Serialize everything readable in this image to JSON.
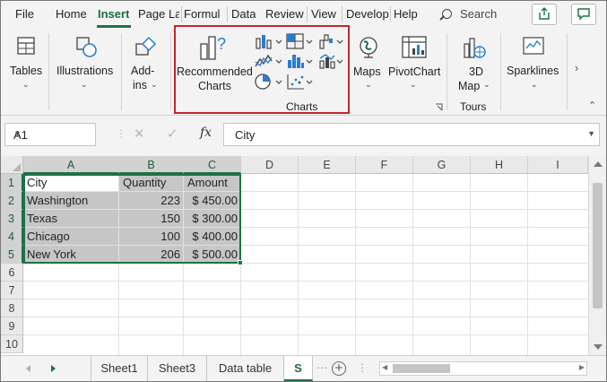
{
  "tabs": [
    {
      "label": "File"
    },
    {
      "label": "Home"
    },
    {
      "label": "Insert",
      "active": true
    },
    {
      "label": "Page La"
    },
    {
      "label": "Formul"
    },
    {
      "label": "Data"
    },
    {
      "label": "Review"
    },
    {
      "label": "View"
    },
    {
      "label": "Develop"
    },
    {
      "label": "Help"
    }
  ],
  "search": {
    "label": "Search"
  },
  "ribbon": {
    "tables": {
      "label": "Tables",
      "icon": "table-icon"
    },
    "illustrations": {
      "label": "Illustrations",
      "icon": "shapes-icon"
    },
    "addins": {
      "label_line1": "Add-",
      "label_line2": "ins",
      "icon": "addins-icon"
    },
    "recommended_charts": {
      "label_line1": "Recommended",
      "label_line2": "Charts",
      "icon": "recommended-charts-icon"
    },
    "charts_group_label": "Charts",
    "maps": {
      "label": "Maps",
      "icon": "globe-icon"
    },
    "pivotchart": {
      "label": "PivotChart",
      "icon": "pivotchart-icon"
    },
    "map3d": {
      "label_line1": "3D",
      "label_line2": "Map",
      "icon": "3d-map-icon"
    },
    "tours_group_label": "Tours",
    "sparklines": {
      "label": "Sparklines",
      "icon": "sparklines-icon"
    },
    "highlight_color": "#c0262d"
  },
  "formula_bar": {
    "name_box": "A1",
    "fx": "fx",
    "content": "City"
  },
  "columns": [
    "A",
    "B",
    "C",
    "D",
    "E",
    "F",
    "G",
    "H",
    "I"
  ],
  "rows": [
    "1",
    "2",
    "3",
    "4",
    "5",
    "6",
    "7",
    "8",
    "9",
    "10"
  ],
  "table": {
    "headers": [
      "City",
      "Quantity",
      "Amount"
    ],
    "rows": [
      [
        "Washington",
        "223",
        "$ 450.00"
      ],
      [
        "Texas",
        "150",
        "$ 300.00"
      ],
      [
        "Chicago",
        "100",
        "$ 400.00"
      ],
      [
        "New York",
        "206",
        "$ 500.00"
      ]
    ]
  },
  "sheets": [
    {
      "label": "Sheet1"
    },
    {
      "label": "Sheet3"
    },
    {
      "label": "Data table"
    },
    {
      "label": "S",
      "active": true
    }
  ],
  "accent_color": "#1e7145"
}
